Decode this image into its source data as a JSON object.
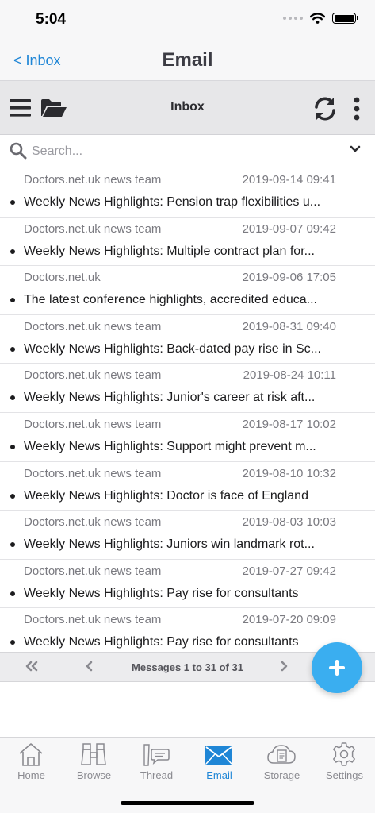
{
  "status_bar": {
    "time": "5:04"
  },
  "nav": {
    "back_label": "< Inbox",
    "title": "Email"
  },
  "toolbar": {
    "title": "Inbox"
  },
  "search": {
    "placeholder": "Search..."
  },
  "emails": [
    {
      "sender": "Doctors.net.uk news team",
      "date": "2019-09-14 09:41",
      "subject": "Weekly News Highlights: Pension trap flexibilities u..."
    },
    {
      "sender": "Doctors.net.uk news team",
      "date": "2019-09-07 09:42",
      "subject": "Weekly News Highlights: Multiple contract plan for..."
    },
    {
      "sender": "Doctors.net.uk",
      "date": "2019-09-06 17:05",
      "subject": "The latest conference highlights, accredited educa..."
    },
    {
      "sender": "Doctors.net.uk news team",
      "date": "2019-08-31 09:40",
      "subject": "Weekly News Highlights: Back-dated pay rise in Sc..."
    },
    {
      "sender": "Doctors.net.uk news team",
      "date": "2019-08-24 10:11",
      "subject": "Weekly News Highlights: Junior's career at risk aft..."
    },
    {
      "sender": "Doctors.net.uk news team",
      "date": "2019-08-17 10:02",
      "subject": "Weekly News Highlights: Support might prevent m..."
    },
    {
      "sender": "Doctors.net.uk news team",
      "date": "2019-08-10 10:32",
      "subject": "Weekly News Highlights: Doctor is face of England"
    },
    {
      "sender": "Doctors.net.uk news team",
      "date": "2019-08-03 10:03",
      "subject": "Weekly News Highlights: Juniors win landmark rot..."
    },
    {
      "sender": "Doctors.net.uk news team",
      "date": "2019-07-27 09:42",
      "subject": "Weekly News Highlights: Pay rise for consultants"
    },
    {
      "sender": "Doctors.net.uk news team",
      "date": "2019-07-20 09:09",
      "subject": "Weekly News Highlights: Pay rise for consultants"
    }
  ],
  "pager": {
    "label": "Messages 1 to 31 of 31"
  },
  "tabs": [
    {
      "label": "Home",
      "icon": "house-icon"
    },
    {
      "label": "Browse",
      "icon": "binoculars-icon"
    },
    {
      "label": "Thread",
      "icon": "thread-icon"
    },
    {
      "label": "Email",
      "icon": "envelope-icon",
      "active": true
    },
    {
      "label": "Storage",
      "icon": "cloud-storage-icon"
    },
    {
      "label": "Settings",
      "icon": "gear-icon"
    }
  ],
  "colors": {
    "accent": "#1f86d6",
    "fab": "#3aaef0"
  }
}
